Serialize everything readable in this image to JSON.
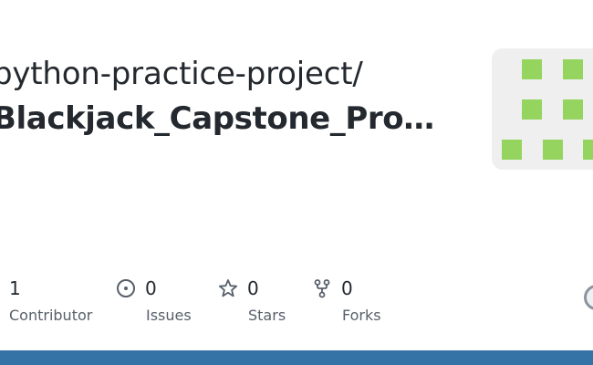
{
  "repo": {
    "owner_path": "python-practice-project/",
    "name": "Blackjack_Capstone_Pro…"
  },
  "stats": [
    {
      "count": "1",
      "label": "Contributor",
      "icon": "contributor-icon"
    },
    {
      "count": "0",
      "label": "Issues",
      "icon": "issue-icon"
    },
    {
      "count": "0",
      "label": "Stars",
      "icon": "star-icon"
    },
    {
      "count": "0",
      "label": "Forks",
      "icon": "fork-icon"
    }
  ],
  "colors": {
    "language_bar": "#3572a5",
    "avatar_pixel": "#95d55f",
    "avatar_bg": "#efefef"
  }
}
